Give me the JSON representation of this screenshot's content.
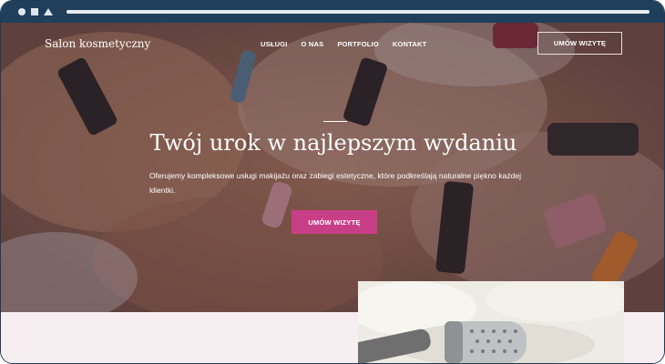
{
  "browser": {
    "icons": [
      "circle-icon",
      "square-icon",
      "triangle-icon"
    ]
  },
  "header": {
    "brand": "Salon kosmetyczny",
    "nav": [
      "USŁUGI",
      "O NAS",
      "PORTFOLIO",
      "KONTAKT"
    ],
    "cta": "UMÓW WIZYTĘ"
  },
  "hero": {
    "title": "Twój urok w najlepszym wydaniu",
    "subtitle": "Oferujemy kompleksowe usługi makijażu oraz zabiegi estetyczne, które podkreślają naturalne piękno każdej klientki.",
    "cta": "UMÓW WIZYTĘ"
  },
  "colors": {
    "accent": "#c93f87",
    "chrome": "#1f3f5b",
    "section_bg": "#f7eef1"
  }
}
